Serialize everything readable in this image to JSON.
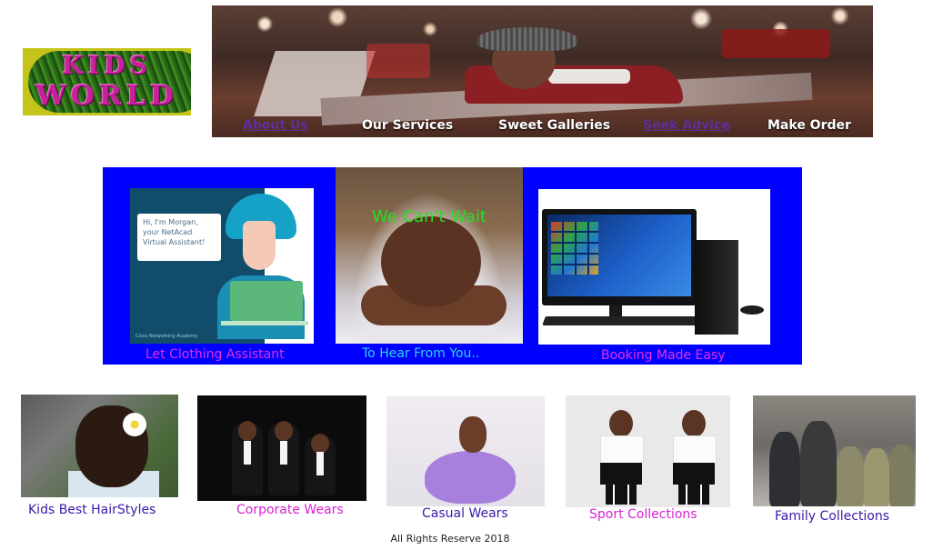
{
  "logo": {
    "line1": "KIDS",
    "line2": "WORLD"
  },
  "nav": {
    "items": [
      {
        "label": "About Us",
        "visited": true
      },
      {
        "label": "Our Services",
        "visited": false
      },
      {
        "label": "Sweet Galleries",
        "visited": false
      },
      {
        "label": "Seek Advice",
        "visited": true
      },
      {
        "label": "Make Order",
        "visited": false
      }
    ]
  },
  "features": {
    "assistant": {
      "caption": "Let Clothing Assistant",
      "bubble_text": "Hi, I'm Morgan, your NetAcad Virtual Assistant!",
      "brand_text": "Cisco Networking Academy",
      "caption_color": "#e42fe0"
    },
    "baby": {
      "overlay": "We Can't Wait",
      "caption": "To Hear From You..",
      "overlay_color": "#27e01f",
      "caption_color": "#27d7e9"
    },
    "computer": {
      "caption": "Booking Made Easy",
      "caption_color": "#e42fe0"
    }
  },
  "gallery": [
    {
      "caption": "Kids Best HairStyles",
      "color": "#3b1aa8"
    },
    {
      "caption": "Corporate Wears",
      "color": "#d81fd2"
    },
    {
      "caption": "Casual Wears",
      "color": "#3b1aa8"
    },
    {
      "caption": "Sport Collections",
      "color": "#d81fd2"
    },
    {
      "caption": "Family Collections",
      "color": "#3b1aa8"
    }
  ],
  "footer": {
    "text": "All Rights Reserve 2018"
  },
  "colors": {
    "panel": "#0000fe",
    "visited_link": "#5d2e9c"
  }
}
